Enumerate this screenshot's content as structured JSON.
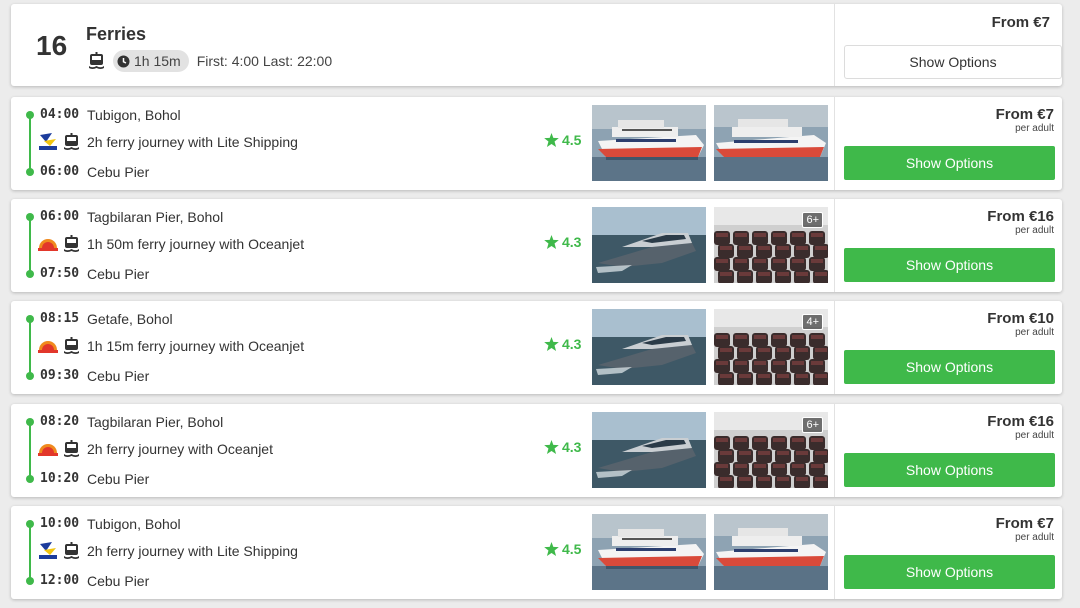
{
  "header": {
    "count": "16",
    "title": "Ferries",
    "duration": "1h 15m",
    "first_last": "First: 4:00 Last: 22:00",
    "price": "From €7",
    "button": "Show Options"
  },
  "routes": [
    {
      "dep_time": "04:00",
      "dep_place": "Tubigon, Bohol",
      "journey": "2h ferry journey with Lite Shipping",
      "rating": "4.5",
      "arr_time": "06:00",
      "arr_place": "Cebu Pier",
      "price": "From €7",
      "per": "per adult",
      "button": "Show Options",
      "operator_logo": "lite-shipping-logo",
      "photo_kind": "lite",
      "more": ""
    },
    {
      "dep_time": "06:00",
      "dep_place": "Tagbilaran Pier, Bohol",
      "journey": "1h 50m ferry journey with Oceanjet",
      "rating": "4.3",
      "arr_time": "07:50",
      "arr_place": "Cebu Pier",
      "price": "From €16",
      "per": "per adult",
      "button": "Show Options",
      "operator_logo": "oceanjet-logo",
      "photo_kind": "ocean",
      "more": "6+"
    },
    {
      "dep_time": "08:15",
      "dep_place": "Getafe, Bohol",
      "journey": "1h 15m ferry journey with Oceanjet",
      "rating": "4.3",
      "arr_time": "09:30",
      "arr_place": "Cebu Pier",
      "price": "From €10",
      "per": "per adult",
      "button": "Show Options",
      "operator_logo": "oceanjet-logo",
      "photo_kind": "ocean",
      "more": "4+"
    },
    {
      "dep_time": "08:20",
      "dep_place": "Tagbilaran Pier, Bohol",
      "journey": "2h ferry journey with Oceanjet",
      "rating": "4.3",
      "arr_time": "10:20",
      "arr_place": "Cebu Pier",
      "price": "From €16",
      "per": "per adult",
      "button": "Show Options",
      "operator_logo": "oceanjet-logo",
      "photo_kind": "ocean",
      "more": "6+"
    },
    {
      "dep_time": "10:00",
      "dep_place": "Tubigon, Bohol",
      "journey": "2h ferry journey with Lite Shipping",
      "rating": "4.5",
      "arr_time": "12:00",
      "arr_place": "Cebu Pier",
      "price": "From €7",
      "per": "per adult",
      "button": "Show Options",
      "operator_logo": "lite-shipping-logo",
      "photo_kind": "lite",
      "more": ""
    }
  ],
  "colors": {
    "accent": "#3fb94a",
    "background": "#ececec"
  }
}
